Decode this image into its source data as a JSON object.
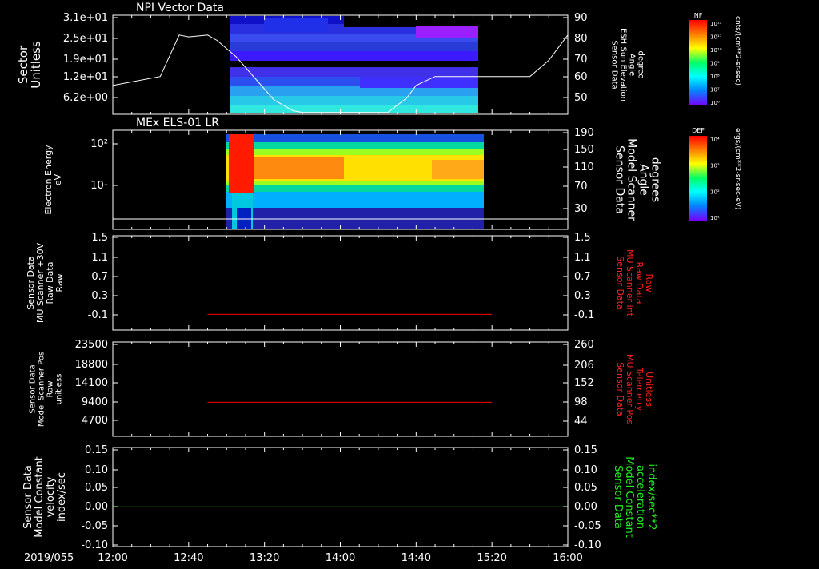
{
  "chart_data": [
    {
      "type": "heatmap",
      "title": "NPI Vector Data",
      "ylabel_left": [
        "Sector",
        "Unitless"
      ],
      "yticks_left": [
        "3.1e+01",
        "2.5e+01",
        "1.9e+01",
        "1.2e+01",
        "6.2e+00"
      ],
      "ylabel_right": [
        "Sensor Data",
        "ESH Sun Elevation",
        "Angle",
        "degree"
      ],
      "yticks_right": [
        "90",
        "80",
        "70",
        "60",
        "50"
      ],
      "line_series": {
        "name": "ESH Sun Elevation Angle",
        "x": [
          "12:00",
          "12:25",
          "12:35",
          "12:40",
          "12:50",
          "12:55",
          "13:05",
          "13:25",
          "13:35",
          "13:40",
          "14:00",
          "14:25",
          "14:35",
          "14:40",
          "14:50",
          "15:00",
          "15:20",
          "15:40",
          "15:50",
          "16:00"
        ],
        "y": [
          56,
          61,
          84,
          83,
          84,
          81,
          72,
          48,
          42,
          41,
          41,
          41,
          49,
          56,
          61,
          61,
          61,
          61,
          70,
          84
        ]
      },
      "colorbar": {
        "label": "NF",
        "unit": "cnts/(cm**2-sr-sec)",
        "ticks": [
          "10¹²",
          "10¹¹",
          "10¹⁰",
          "10⁹",
          "10⁸",
          "10⁷",
          "10⁶"
        ]
      }
    },
    {
      "type": "heatmap",
      "title": "MEx ELS-01 LR",
      "ylabel_left": [
        "Electron Energy",
        "eV"
      ],
      "yticks_left": [
        "10²",
        "10¹"
      ],
      "ylabel_right": [
        "Sensor Data",
        "Model Scanner",
        "Angle",
        "degrees"
      ],
      "yticks_right": [
        "190",
        "150",
        "110",
        "70",
        "30"
      ],
      "line_series": {
        "name": "Model Scanner Angle",
        "x": [
          "12:00",
          "16:00"
        ],
        "y": [
          10,
          10
        ]
      },
      "colorbar": {
        "label": "DEF",
        "unit": "ergs/(cm**2-sr-sec-eV)",
        "ticks": [
          "10⁴",
          "10³",
          "10²",
          "10¹"
        ]
      }
    },
    {
      "type": "line",
      "ylabel_left": [
        "Sensor Data",
        "MU Scanner +30V",
        "Raw Data",
        "Raw"
      ],
      "yticks_left": [
        "1.5",
        "1.1",
        "0.7",
        "0.3",
        "-0.1"
      ],
      "ylabel_right": [
        "Sensor Data",
        "MU Scanner Int",
        "Raw Data",
        "Raw"
      ],
      "yticks_right": [
        "1.5",
        "1.1",
        "0.7",
        "0.3",
        "-0.1"
      ],
      "ylim": [
        -0.3,
        1.5
      ],
      "series": [
        {
          "x": [
            "12:50",
            "15:20"
          ],
          "y": [
            0.0,
            0.0
          ],
          "color": "#ff0000"
        }
      ]
    },
    {
      "type": "line",
      "ylabel_left": [
        "Sensor Data",
        "Model Scanner Pos",
        "Raw",
        "unitless"
      ],
      "yticks_left": [
        "23500",
        "18800",
        "14100",
        "9400",
        "4700"
      ],
      "ylabel_right": [
        "Sensor Data",
        "MU Scanner Pos",
        "Telemetry",
        "Unitless"
      ],
      "yticks_right": [
        "260",
        "206",
        "152",
        "98",
        "44"
      ],
      "ylim": [
        0,
        23500
      ],
      "series": [
        {
          "x": [
            "12:50",
            "15:20"
          ],
          "y": [
            8500,
            8500
          ],
          "color": "#ff0000"
        }
      ]
    },
    {
      "type": "line",
      "ylabel_left": [
        "Sensor Data",
        "Model Constant",
        "velocity",
        "index/sec"
      ],
      "yticks_left": [
        "0.15",
        "0.10",
        "0.05",
        "0.00",
        "-0.05",
        "-0.10"
      ],
      "ylabel_right": [
        "Sensor Data",
        "Model Constant",
        "acceleration",
        "index/sec**2"
      ],
      "yticks_right": [
        "0.15",
        "0.10",
        "0.05",
        "0.00",
        "-0.05",
        "-0.10"
      ],
      "ylim": [
        -0.1,
        0.15
      ],
      "series": [
        {
          "x": [
            "12:00",
            "16:00"
          ],
          "y": [
            0.0,
            0.0
          ],
          "color": "#00ff00"
        }
      ]
    }
  ],
  "xaxis": {
    "date_label": "2019/055",
    "ticks": [
      "12:00",
      "12:40",
      "13:20",
      "14:00",
      "14:40",
      "15:20",
      "16:00"
    ]
  },
  "colors": {
    "panel3_right": "#ff2020",
    "panel4_right": "#ff2020",
    "panel5_right": "#22ee22"
  }
}
